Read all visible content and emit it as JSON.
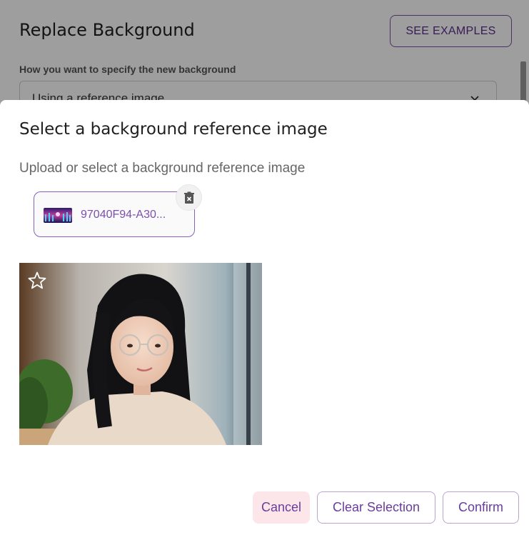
{
  "background_panel": {
    "title": "Replace Background",
    "examples_button": "SEE EXAMPLES",
    "field_label": "How you want to specify the new background",
    "select_value": "Using a reference image"
  },
  "dialog": {
    "title": "Select a background reference image",
    "subtitle": "Upload or select a background reference image",
    "uploaded_file": {
      "name": "97040F94-A30..."
    },
    "icons": {
      "delete": "trash-icon",
      "favorite": "star-icon",
      "chevron": "chevron-down-icon"
    },
    "buttons": {
      "cancel": "Cancel",
      "clear": "Clear Selection",
      "confirm": "Confirm"
    }
  },
  "colors": {
    "accent": "#7b4fb0",
    "cancel_bg": "#fde6ea"
  }
}
